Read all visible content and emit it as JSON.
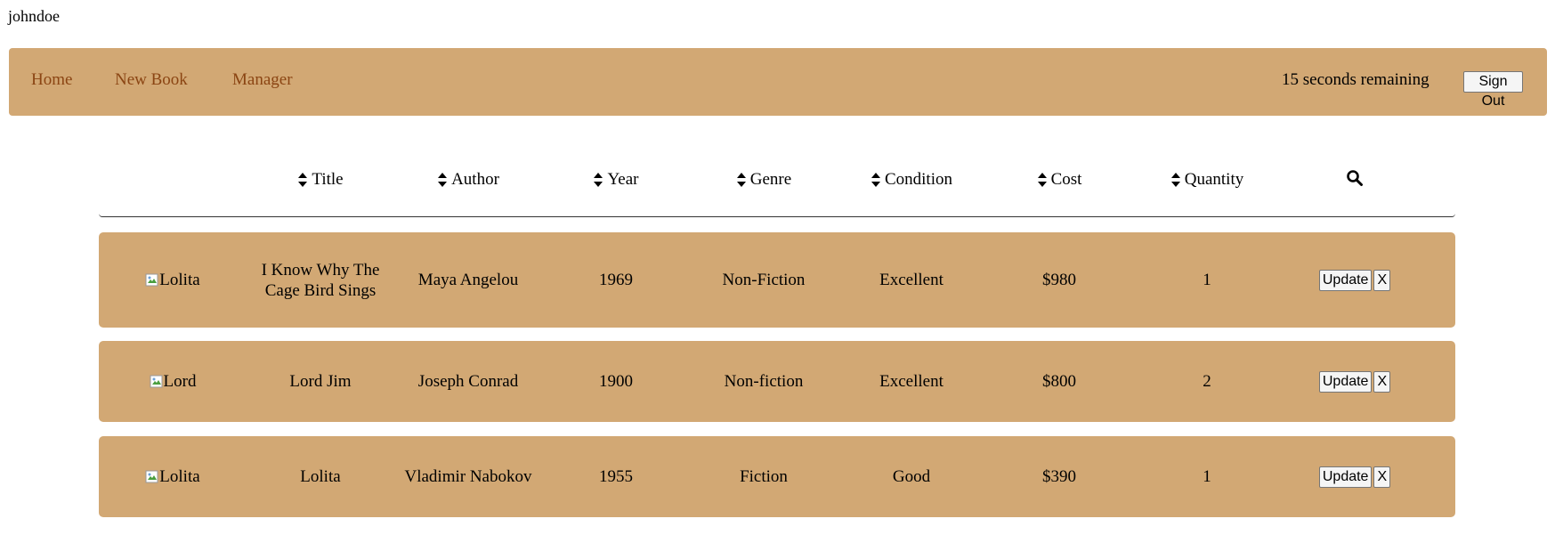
{
  "user": {
    "name": "johndoe"
  },
  "nav": {
    "links": [
      "Home",
      "New Book",
      "Manager"
    ],
    "timer": "15 seconds remaining",
    "signout_label": "Sign Out"
  },
  "table": {
    "columns": [
      "Title",
      "Author",
      "Year",
      "Genre",
      "Condition",
      "Cost",
      "Quantity"
    ],
    "search_icon": "search-icon",
    "rows": [
      {
        "img_alt": "Lolita",
        "title": "I Know Why The Cage Bird Sings",
        "author": "Maya Angelou",
        "year": "1969",
        "genre": "Non-Fiction",
        "condition": "Excellent",
        "cost": "$980",
        "quantity": "1"
      },
      {
        "img_alt": "Lord",
        "title": "Lord Jim",
        "author": "Joseph Conrad",
        "year": "1900",
        "genre": "Non-fiction",
        "condition": "Excellent",
        "cost": "$800",
        "quantity": "2"
      },
      {
        "img_alt": "Lolita",
        "title": "Lolita",
        "author": "Vladimir Nabokov",
        "year": "1955",
        "genre": "Fiction",
        "condition": "Good",
        "cost": "$390",
        "quantity": "1"
      }
    ],
    "update_label": "Update",
    "delete_label": "X"
  },
  "colors": {
    "accent": "#d2a874",
    "link": "#8b4513"
  }
}
